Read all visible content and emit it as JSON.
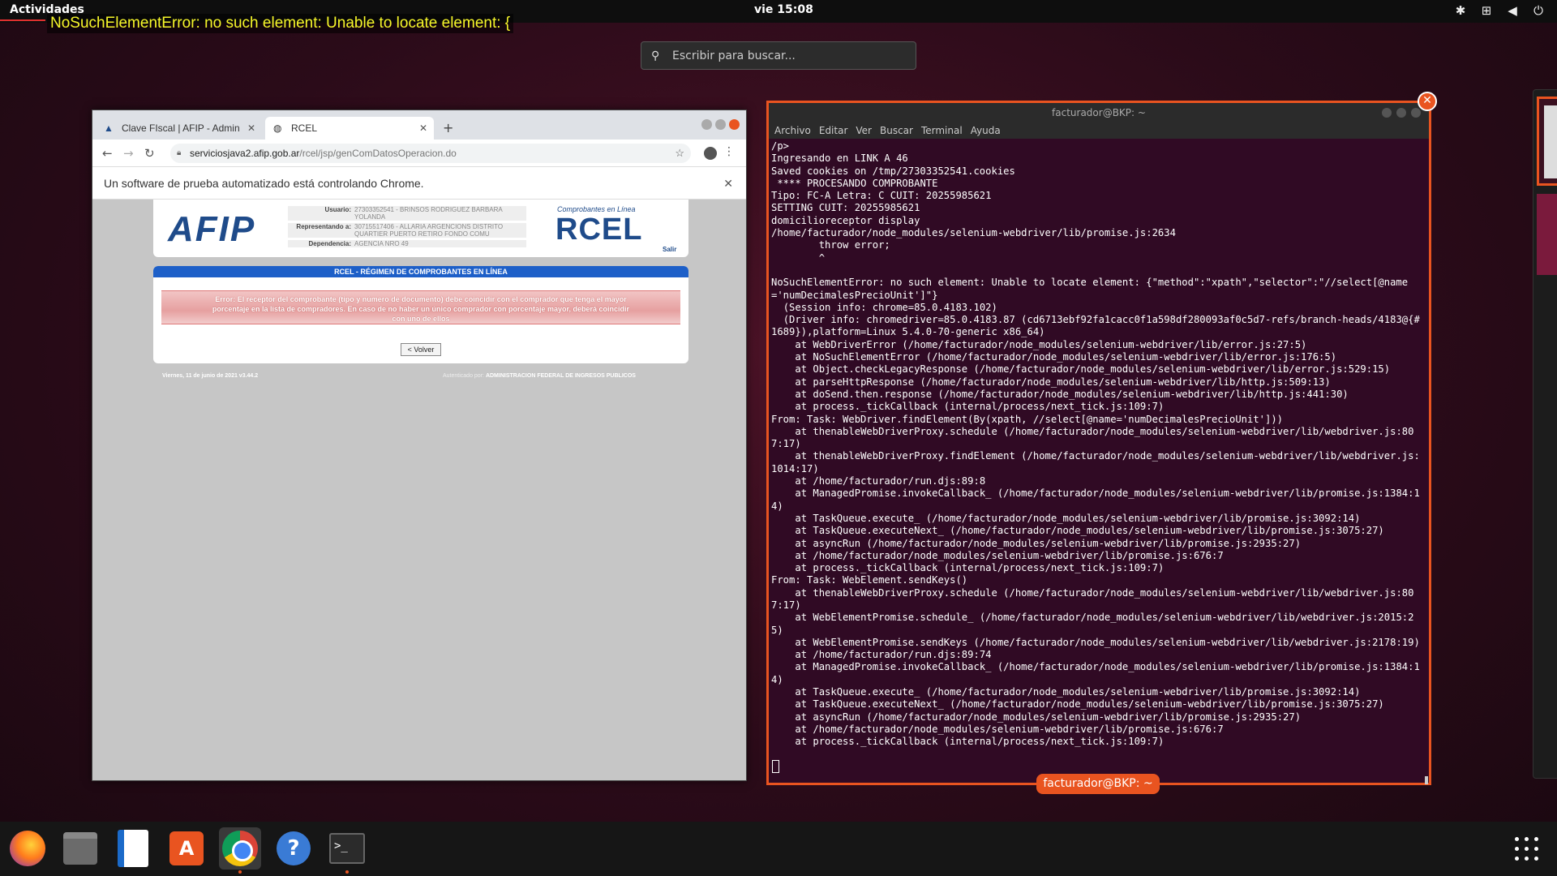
{
  "topbar": {
    "activities": "Actividades",
    "clock": "vie 15:08",
    "tray_icons": [
      "bluetooth-icon",
      "network-icon",
      "volume-icon",
      "power-icon"
    ]
  },
  "overlay_error": "NoSuchElementError: no such element: Unable to locate element: {",
  "search": {
    "placeholder": "Escribir para buscar..."
  },
  "chrome": {
    "tabs": [
      {
        "label": "Clave FIscal | AFIP - Admin",
        "icon": "afip-icon"
      },
      {
        "label": "RCEL",
        "icon": "globe-icon"
      }
    ],
    "url_host": "serviciosjava2.afip.gob.ar",
    "url_path": "/rcel/jsp/genComDatosOperacion.do",
    "infobar": "Un software de prueba automatizado está controlando Chrome.",
    "page": {
      "afip_logo": "AFIP",
      "usuario_label": "Usuario:",
      "usuario_value": "27303352541 - BRINSOS RODRIGUEZ BARBARA YOLANDA",
      "representando_label": "Representando a:",
      "representando_value": "30715517406 - ALLARIA ARGENCIONS DISTRITO QUARTIER PUERTO RETIRO FONDO COMU",
      "dependencia_label": "Dependencia:",
      "dependencia_value": "AGENCIA NRO 49",
      "rcel_caption": "Comprobantes en Línea",
      "rcel_logo": "RCEL",
      "salir": "Salir",
      "panel_title": "RCEL - RÉGIMEN DE COMPROBANTES EN LÍNEA",
      "error_text": "Error: El receptor del comprobante (tipo y número de documento) debe coincidir con el comprador que tenga el mayor porcentaje en la lista de compradores. En caso de no haber un único comprador con porcentaje mayor, deberá coincidir con uno de ellos",
      "volver": "< Volver",
      "footer_left": "Viernes, 11 de junio de 2021 v3.44.2",
      "footer_right_prefix": "Autenticado por:",
      "footer_right_org": "ADMINISTRACION FEDERAL DE INGRESOS PUBLICOS"
    }
  },
  "terminal": {
    "title": "facturador@BKP: ~",
    "menu": [
      "Archivo",
      "Editar",
      "Ver",
      "Buscar",
      "Terminal",
      "Ayuda"
    ],
    "output": "/p>\nIngresando en LINK A 46\nSaved cookies on /tmp/27303352541.cookies\n **** PROCESANDO COMPROBANTE\nTipo: FC-A Letra: C CUIT: 20255985621\nSETTING CUIT: 20255985621\ndomicilioreceptor display\n/home/facturador/node_modules/selenium-webdriver/lib/promise.js:2634\n        throw error;\n        ^\n\nNoSuchElementError: no such element: Unable to locate element: {\"method\":\"xpath\",\"selector\":\"//select[@name='numDecimalesPrecioUnit']\"}\n  (Session info: chrome=85.0.4183.102)\n  (Driver info: chromedriver=85.0.4183.87 (cd6713ebf92fa1cacc0f1a598df280093af0c5d7-refs/branch-heads/4183@{#1689}),platform=Linux 5.4.0-70-generic x86_64)\n    at WebDriverError (/home/facturador/node_modules/selenium-webdriver/lib/error.js:27:5)\n    at NoSuchElementError (/home/facturador/node_modules/selenium-webdriver/lib/error.js:176:5)\n    at Object.checkLegacyResponse (/home/facturador/node_modules/selenium-webdriver/lib/error.js:529:15)\n    at parseHttpResponse (/home/facturador/node_modules/selenium-webdriver/lib/http.js:509:13)\n    at doSend.then.response (/home/facturador/node_modules/selenium-webdriver/lib/http.js:441:30)\n    at process._tickCallback (internal/process/next_tick.js:109:7)\nFrom: Task: WebDriver.findElement(By(xpath, //select[@name='numDecimalesPrecioUnit']))\n    at thenableWebDriverProxy.schedule (/home/facturador/node_modules/selenium-webdriver/lib/webdriver.js:807:17)\n    at thenableWebDriverProxy.findElement (/home/facturador/node_modules/selenium-webdriver/lib/webdriver.js:1014:17)\n    at /home/facturador/run.djs:89:8\n    at ManagedPromise.invokeCallback_ (/home/facturador/node_modules/selenium-webdriver/lib/promise.js:1384:14)\n    at TaskQueue.execute_ (/home/facturador/node_modules/selenium-webdriver/lib/promise.js:3092:14)\n    at TaskQueue.executeNext_ (/home/facturador/node_modules/selenium-webdriver/lib/promise.js:3075:27)\n    at asyncRun (/home/facturador/node_modules/selenium-webdriver/lib/promise.js:2935:27)\n    at /home/facturador/node_modules/selenium-webdriver/lib/promise.js:676:7\n    at process._tickCallback (internal/process/next_tick.js:109:7)\nFrom: Task: WebElement.sendKeys()\n    at thenableWebDriverProxy.schedule (/home/facturador/node_modules/selenium-webdriver/lib/webdriver.js:807:17)\n    at WebElementPromise.schedule_ (/home/facturador/node_modules/selenium-webdriver/lib/webdriver.js:2015:25)\n    at WebElementPromise.sendKeys (/home/facturador/node_modules/selenium-webdriver/lib/webdriver.js:2178:19)\n    at /home/facturador/run.djs:89:74\n    at ManagedPromise.invokeCallback_ (/home/facturador/node_modules/selenium-webdriver/lib/promise.js:1384:14)\n    at TaskQueue.execute_ (/home/facturador/node_modules/selenium-webdriver/lib/promise.js:3092:14)\n    at TaskQueue.executeNext_ (/home/facturador/node_modules/selenium-webdriver/lib/promise.js:3075:27)\n    at asyncRun (/home/facturador/node_modules/selenium-webdriver/lib/promise.js:2935:27)\n    at /home/facturador/node_modules/selenium-webdriver/lib/promise.js:676:7\n    at process._tickCallback (internal/process/next_tick.js:109:7)",
    "label": "facturador@BKP: ~"
  },
  "dock": {
    "items": [
      "firefox-icon",
      "files-icon",
      "writer-icon",
      "software-store-icon",
      "chrome-icon",
      "help-icon",
      "terminal-icon"
    ],
    "accent": "#e95420"
  }
}
